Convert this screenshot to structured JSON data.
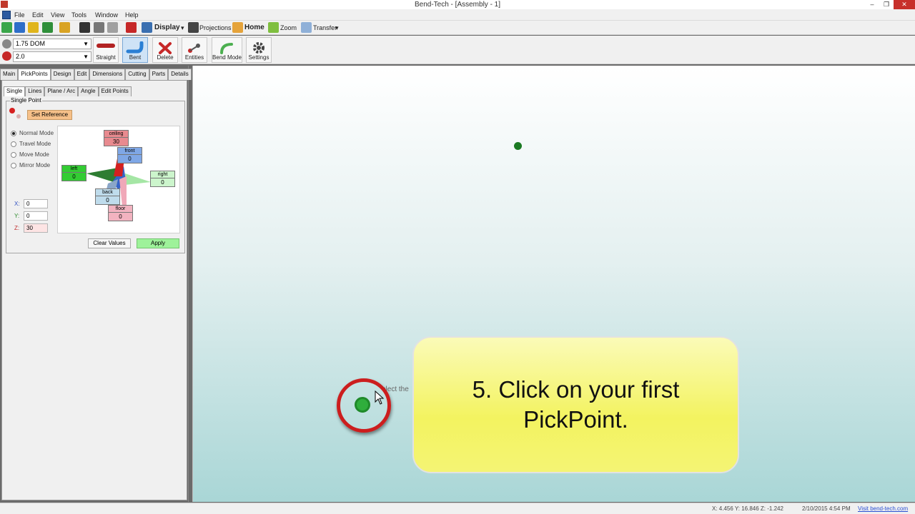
{
  "window": {
    "title": "Bend-Tech - [Assembly - 1]"
  },
  "menu": {
    "items": [
      "File",
      "Edit",
      "View",
      "Tools",
      "Window",
      "Help"
    ]
  },
  "toolbar1": {
    "display_label": "Display",
    "projections_label": "Projections",
    "home_label": "Home",
    "zoom_label": "Zoom",
    "transfer_label": "Transfer"
  },
  "toolbar2": {
    "tube_size": "1.75 DOM",
    "clr_value": "2.0",
    "buttons": [
      "Straight",
      "Bent",
      "Delete",
      "Entities",
      "Bend Mode",
      "Settings"
    ]
  },
  "left_panel": {
    "main_tabs": [
      "Main",
      "PickPoints",
      "Design",
      "Edit",
      "Dimensions",
      "Cutting",
      "Parts",
      "Details"
    ],
    "sub_tabs": [
      "Single",
      "Lines",
      "Plane / Arc",
      "Angle",
      "Edit Points"
    ],
    "group_title": "Single Point",
    "set_reference_label": "Set Reference",
    "modes": [
      "Normal Mode",
      "Travel Mode",
      "Move Mode",
      "Mirror Mode"
    ],
    "directions": {
      "ceiling": {
        "label": "ceiling",
        "value": "30"
      },
      "front": {
        "label": "front",
        "value": "0"
      },
      "left": {
        "label": "left",
        "value": "0"
      },
      "right": {
        "label": "right",
        "value": "0"
      },
      "back": {
        "label": "back",
        "value": "0"
      },
      "floor": {
        "label": "floor",
        "value": "0"
      }
    },
    "coords": {
      "x_label": "X:",
      "x": "0",
      "y_label": "Y:",
      "y": "0",
      "z_label": "Z:",
      "z": "30"
    },
    "clear_label": "Clear Values",
    "apply_label": "Apply"
  },
  "viewport": {
    "hint_text": "elect the",
    "callout_line1": "5. Click on your first",
    "callout_line2": "PickPoint."
  },
  "status": {
    "coords": "X: 4.456  Y: 16.846  Z: -1.242",
    "datetime": "2/10/2015   4:54 PM",
    "link": "Visit bend-tech.com"
  },
  "colors": {
    "ceiling": "#e88a8f",
    "front": "#7fa7e6",
    "left": "#33cc33",
    "right": "#ccf5cc",
    "back": "#bfdcec",
    "floor": "#f2b3c0",
    "callout": "#f3f360",
    "ring": "#cc1e1e",
    "point": "#1b7a23"
  }
}
